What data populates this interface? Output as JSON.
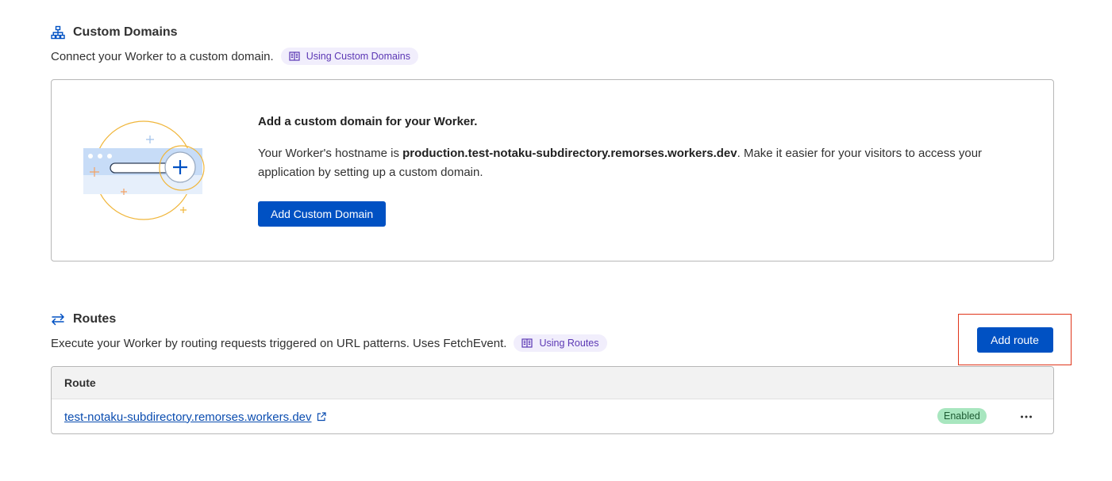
{
  "custom_domains": {
    "title": "Custom Domains",
    "description": "Connect your Worker to a custom domain.",
    "doc_link": "Using Custom Domains",
    "card": {
      "heading": "Add a custom domain for your Worker.",
      "text_before": "Your Worker's hostname is ",
      "hostname": "production.test-notaku-subdirectory.remorses.workers.dev",
      "text_after": ". Make it easier for your visitors to access your application by setting up a custom domain.",
      "button_label": "Add Custom Domain"
    }
  },
  "routes": {
    "title": "Routes",
    "description": "Execute your Worker by routing requests triggered on URL patterns. Uses FetchEvent.",
    "doc_link": "Using Routes",
    "add_button_label": "Add route",
    "table": {
      "header": "Route",
      "rows": [
        {
          "route": "test-notaku-subdirectory.remorses.workers.dev",
          "status": "Enabled"
        }
      ]
    }
  },
  "icons": {
    "custom_domains": "sitemap-icon",
    "routes": "arrows-exchange-icon",
    "doc": "book-icon",
    "external": "external-link-icon",
    "menu": "more-horizontal-icon"
  },
  "colors": {
    "primary": "#0051c3",
    "chip_bg": "#f1eefc",
    "chip_text": "#5b37b4",
    "enabled_badge": "#a8e6bf",
    "highlight": "#e0351a"
  }
}
